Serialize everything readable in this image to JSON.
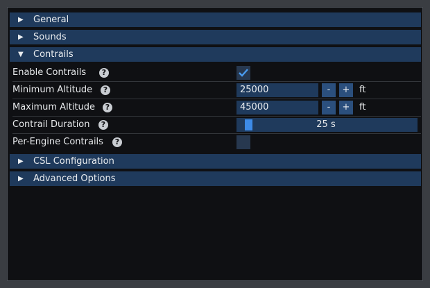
{
  "sections": {
    "general": {
      "label": "General",
      "arrow": "▶"
    },
    "sounds": {
      "label": "Sounds",
      "arrow": "▶"
    },
    "contrails": {
      "label": "Contrails",
      "arrow": "▼"
    },
    "csl": {
      "label": "CSL Configuration",
      "arrow": "▶"
    },
    "advanced": {
      "label": "Advanced Options",
      "arrow": "▶"
    }
  },
  "help_glyph": "?",
  "contrails": {
    "enable": {
      "label": "Enable Contrails",
      "checked": true
    },
    "min_altitude": {
      "label": "Minimum Altitude",
      "value": "25000",
      "minus": "-",
      "plus": "+",
      "unit": "ft"
    },
    "max_altitude": {
      "label": "Maximum Altitude",
      "value": "45000",
      "minus": "-",
      "plus": "+",
      "unit": "ft"
    },
    "duration": {
      "label": "Contrail Duration",
      "value": "25 s",
      "fraction": 0.04
    },
    "per_engine": {
      "label": "Per-Engine Contrails",
      "checked": false
    }
  },
  "colors": {
    "header": "#1f3a5c",
    "accent": "#3d8be8",
    "background": "#0f1013"
  }
}
